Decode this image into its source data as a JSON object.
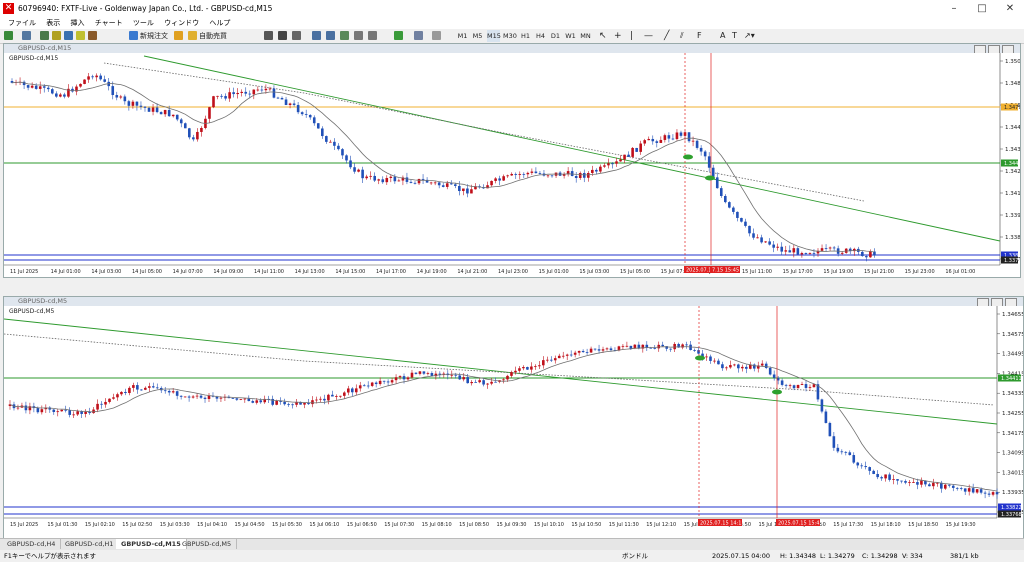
{
  "window": {
    "title": "60796940: FXTF-Live - Goldenway Japan Co., Ltd. - GBPUSD-cd,M15"
  },
  "menu": [
    "ファイル",
    "表示",
    "挿入",
    "チャート",
    "ツール",
    "ウィンドウ",
    "ヘルプ"
  ],
  "toolbar": {
    "new_order": "新規注文",
    "auto_trade": "自動売買",
    "timeframes": [
      "M1",
      "M5",
      "M15",
      "M30",
      "H1",
      "H4",
      "D1",
      "W1",
      "MN"
    ]
  },
  "top_chart": {
    "label": "GBPUSD-cd,M15",
    "price_ticks": [
      "1.35035",
      "1.34810",
      "1.34680",
      "1.34450",
      "1.34335",
      "1.34220",
      "1.34105",
      "1.33990",
      "1.33875",
      "1.33760"
    ],
    "price_tags": {
      "orange": "1.34798",
      "green": "1.34421",
      "blue": "1.33870",
      "black": "1.33768"
    },
    "time_ticks": [
      "11 Jul 2025",
      "14 Jul 01:00",
      "14 Jul 03:00",
      "14 Jul 05:00",
      "14 Jul 07:00",
      "14 Jul 09:00",
      "14 Jul 11:00",
      "14 Jul 13:00",
      "14 Jul 15:00",
      "14 Jul 17:00",
      "14 Jul 19:00",
      "14 Jul 21:00",
      "14 Jul 23:00",
      "15 Jul 01:00",
      "15 Jul 03:00",
      "15 Jul 05:00",
      "15 Jul 07:00",
      "15 Jul 09:00",
      "15 Jul 11:00",
      "15 Jul 17:00",
      "15 Jul 19:00",
      "15 Jul 21:00",
      "15 Jul 23:00",
      "16 Jul 01:00"
    ],
    "marker_labels": [
      "2025.07.15 14:15",
      "7.15 15:45"
    ]
  },
  "bottom_chart": {
    "label": "GBPUSD-cd,M5",
    "price_ticks": [
      "1.34655",
      "1.34575",
      "1.34495",
      "1.34415",
      "1.34335",
      "1.34255",
      "1.34175",
      "1.34095",
      "1.34015",
      "1.33935",
      "1.33855"
    ],
    "price_tags": {
      "green": "1.34411",
      "blue": "1.33822",
      "black": "1.33768"
    },
    "time_ticks": [
      "15 Jul 2025",
      "15 Jul 01:30",
      "15 Jul 02:10",
      "15 Jul 02:50",
      "15 Jul 03:30",
      "15 Jul 04:10",
      "15 Jul 04:50",
      "15 Jul 05:30",
      "15 Jul 06:10",
      "15 Jul 06:50",
      "15 Jul 07:30",
      "15 Jul 08:10",
      "15 Jul 08:50",
      "15 Jul 09:30",
      "15 Jul 10:10",
      "15 Jul 10:50",
      "15 Jul 11:30",
      "15 Jul 12:10",
      "15 Jul 12:50",
      "15 Jul 14:50",
      "15 Jul 16:10",
      "15 Jul 16:50",
      "15 Jul 17:30",
      "15 Jul 18:10",
      "15 Jul 18:50",
      "15 Jul 19:30"
    ],
    "marker_labels": [
      "2025.07.15 14:15",
      "2025.07.15 15:45"
    ]
  },
  "tabs": [
    "GBPUSD-cd,H4",
    "GBPUSD-cd,H1",
    "GBPUSD-cd,M15",
    "GBPUSD-cd,M5"
  ],
  "status": {
    "left": "F1キーでヘルプが表示されます",
    "profile": "ボンドル",
    "datetime": "2025.07.15 04:00",
    "high": "H: 1.34348",
    "low": "L: 1.34279",
    "close": "C: 1.34298",
    "volume": "V: 334",
    "traffic": "381/1 kb"
  },
  "colors": {
    "up": "#c0101a",
    "down": "#2050b8",
    "ma": "#707070",
    "trend": "#2e9a2e",
    "orange_line": "#f0b030",
    "marker": "#e02020",
    "blue_line": "#2233cc"
  }
}
